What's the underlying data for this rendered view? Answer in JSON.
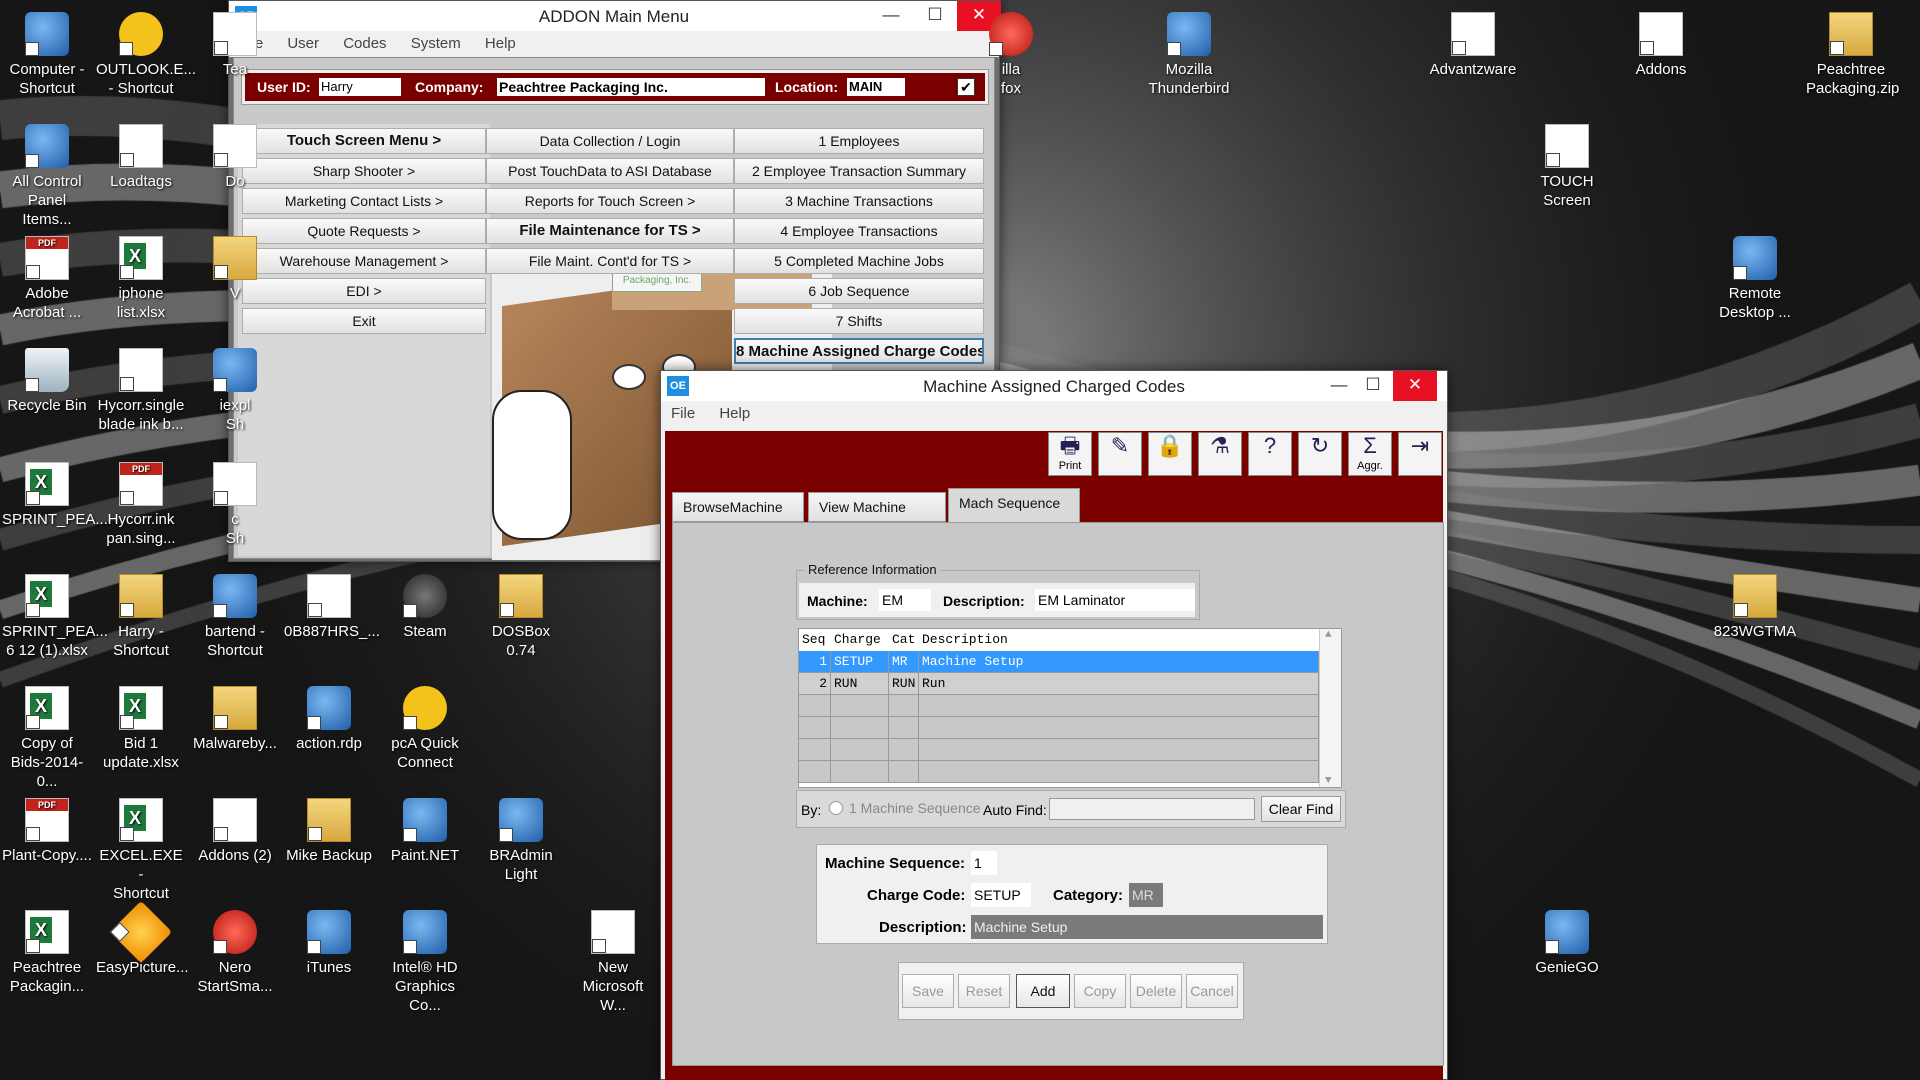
{
  "desktop": {
    "icons": [
      {
        "label": "Computer -\nShortcut",
        "icon": "computer-icon"
      },
      {
        "label": "OUTLOOK.E...\n- Shortcut",
        "icon": "outlook-icon"
      },
      {
        "label": "Tea",
        "icon": "file-icon"
      },
      {
        "label": "All Control\nPanel Items...",
        "icon": "control-panel-icon"
      },
      {
        "label": "Loadtags",
        "icon": "file-icon"
      },
      {
        "label": "Do",
        "icon": "file-icon"
      },
      {
        "label": "Adobe\nAcrobat ...",
        "icon": "acrobat-icon"
      },
      {
        "label": "iphone\nlist.xlsx",
        "icon": "excel-file-icon"
      },
      {
        "label": "V",
        "icon": "folder-icon"
      },
      {
        "label": "Recycle Bin",
        "icon": "recycle-bin-icon"
      },
      {
        "label": "Hycorr.single\nblade ink b...",
        "icon": "image-file-icon"
      },
      {
        "label": "iexpl\nSh",
        "icon": "ie-icon"
      },
      {
        "label": "SPRINT_PEA...",
        "icon": "excel-file-icon"
      },
      {
        "label": "Hycorr.ink\npan.sing...",
        "icon": "pdf-file-icon"
      },
      {
        "label": "c\nSh",
        "icon": "file-icon"
      },
      {
        "label": "SPRINT_PEA...\n6 12 (1).xlsx",
        "icon": "excel-file-icon"
      },
      {
        "label": "Harry -\nShortcut",
        "icon": "folder-icon"
      },
      {
        "label": "bartend -\nShortcut",
        "icon": "bartender-icon"
      },
      {
        "label": "0B887HRS_...",
        "icon": "file-icon"
      },
      {
        "label": "Steam",
        "icon": "steam-icon"
      },
      {
        "label": "DOSBox 0.74",
        "icon": "dosbox-icon"
      },
      {
        "label": "Copy of\nBids-2014-0...",
        "icon": "excel-file-icon"
      },
      {
        "label": "Bid 1\nupdate.xlsx",
        "icon": "excel-file-icon"
      },
      {
        "label": "Malwareby...",
        "icon": "folder-icon"
      },
      {
        "label": "action.rdp",
        "icon": "remote-desktop-icon"
      },
      {
        "label": "pcA Quick\nConnect",
        "icon": "pcanywhere-icon"
      },
      {
        "label": "Plant-Copy....",
        "icon": "pdf-file-icon"
      },
      {
        "label": "EXCEL.EXE -\nShortcut",
        "icon": "excel-app-icon"
      },
      {
        "label": "Addons (2)",
        "icon": "file-icon"
      },
      {
        "label": "Mike Backup",
        "icon": "folder-icon"
      },
      {
        "label": "Paint.NET",
        "icon": "paintnet-icon"
      },
      {
        "label": "BRAdmin\nLight",
        "icon": "bradmin-icon"
      },
      {
        "label": "Peachtree\nPackagin...",
        "icon": "excel-file-icon"
      },
      {
        "label": "EasyPicture...",
        "icon": "easypicture-icon"
      },
      {
        "label": "Nero\nStartSma...",
        "icon": "nero-icon"
      },
      {
        "label": "iTunes",
        "icon": "itunes-icon"
      },
      {
        "label": "Intel® HD\nGraphics Co...",
        "icon": "intel-graphics-icon"
      },
      {
        "label": "New\nMicrosoft W...",
        "icon": "word-file-icon"
      },
      {
        "label": "illa\nfox",
        "icon": "firefox-icon"
      },
      {
        "label": "Mozilla\nThunderbird",
        "icon": "thunderbird-icon"
      },
      {
        "label": "Advantzware",
        "icon": "file-icon"
      },
      {
        "label": "Addons",
        "icon": "file-icon"
      },
      {
        "label": "Peachtree\nPackaging.zip",
        "icon": "zip-folder-icon"
      },
      {
        "label": "TOUCH\nScreen",
        "icon": "file-icon"
      },
      {
        "label": "Remote\nDesktop ...",
        "icon": "remote-desktop-icon"
      },
      {
        "label": "823WGTMA",
        "icon": "folder-icon"
      },
      {
        "label": "GenieGO",
        "icon": "geniego-icon"
      }
    ]
  },
  "addon_window": {
    "app_icon": "OE",
    "title": "ADDON Main Menu",
    "menu": [
      "File",
      "User",
      "Codes",
      "System",
      "Help"
    ],
    "user_id_label": "User ID:",
    "user_id": "Harry",
    "company_label": "Company:",
    "company": "Peachtree Packaging Inc.",
    "location_label": "Location:",
    "location": "MAIN",
    "col1": [
      "Touch Screen Menu >",
      "Sharp Shooter >",
      "Marketing Contact Lists >",
      "Quote Requests >",
      "Warehouse Management >",
      "EDI >",
      "Exit"
    ],
    "col2": [
      "Data Collection / Login",
      "Post TouchData to ASI Database",
      "Reports for Touch Screen >",
      "File Maintenance for TS >",
      "File Maint. Cont'd for TS >"
    ],
    "col3": [
      "1 Employees",
      "2 Employee Transaction Summary",
      "3 Machine Transactions",
      "4 Employee Transactions",
      "5 Completed Machine Jobs",
      "6 Job Sequence",
      "7 Shifts",
      "8 Machine Assigned Charge Codes"
    ],
    "logo_text": "Packaging, Inc."
  },
  "mac_window": {
    "app_icon": "OE",
    "title": "Machine Assigned Charged Codes",
    "menu": [
      "File",
      "Help"
    ],
    "toolbar": [
      {
        "label": "Print",
        "icon": "printer-icon"
      },
      {
        "label": "",
        "icon": "pen-icon"
      },
      {
        "label": "",
        "icon": "lock-icon"
      },
      {
        "label": "",
        "icon": "filter-icon"
      },
      {
        "label": "",
        "icon": "help-icon"
      },
      {
        "label": "",
        "icon": "refresh-icon"
      },
      {
        "label": "Aggr.",
        "icon": "sigma-icon"
      },
      {
        "label": "",
        "icon": "exit-icon"
      }
    ],
    "tabs": [
      "BrowseMachine",
      "View Machine",
      "Mach Sequence"
    ],
    "ref_legend": "Reference Information",
    "machine_label": "Machine:",
    "machine": "EM",
    "desc_label": "Description:",
    "desc": "EM Laminator",
    "grid_headers": [
      "Seq",
      "Charge",
      "Cat",
      "Description"
    ],
    "grid_rows": [
      [
        "1",
        "SETUP",
        "MR",
        "Machine Setup"
      ],
      [
        "2",
        "RUN",
        "RUN",
        "Run"
      ]
    ],
    "by_label": "By:",
    "by_option": "1 Machine Sequence",
    "auto_find_label": "Auto Find:",
    "auto_find_value": "",
    "clear_find": "Clear Find",
    "seq_label": "Machine Sequence:",
    "seq_value": "1",
    "charge_label": "Charge Code:",
    "charge_value": "SETUP",
    "cat_label": "Category:",
    "cat_value": "MR",
    "detail_desc_label": "Description:",
    "detail_desc_value": "Machine Setup",
    "buttons": [
      "Save",
      "Reset",
      "Add",
      "Copy",
      "Delete",
      "Cancel"
    ]
  },
  "colors": {
    "accent_red": "#6e0000",
    "selection_blue": "#3399ff",
    "close_red": "#e81123"
  }
}
